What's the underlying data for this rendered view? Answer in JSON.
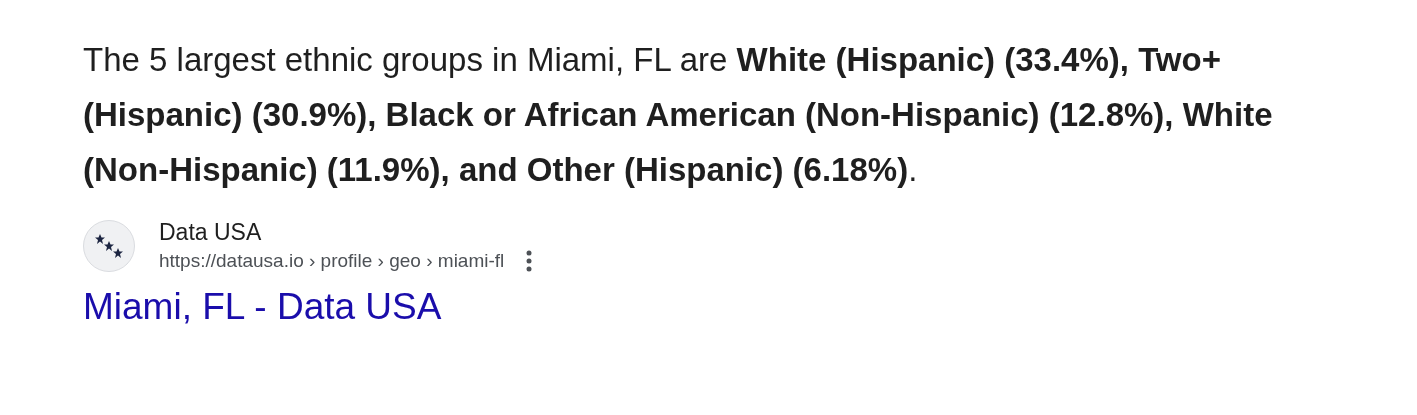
{
  "snippet": {
    "text": "The 5 largest ethnic groups in Miami, FL are **White (Hispanic) (33.4%), Two+ (Hispanic) (30.9%), Black or African American (Non-Hispanic) (12.8%), White (Non-Hispanic) (11.9%), and Other (Hispanic) (6.18%)**."
  },
  "source": {
    "site_name": "Data USA",
    "url": "https://datausa.io › profile › geo › miami-fl"
  },
  "result_title": "Miami, FL - Data USA"
}
